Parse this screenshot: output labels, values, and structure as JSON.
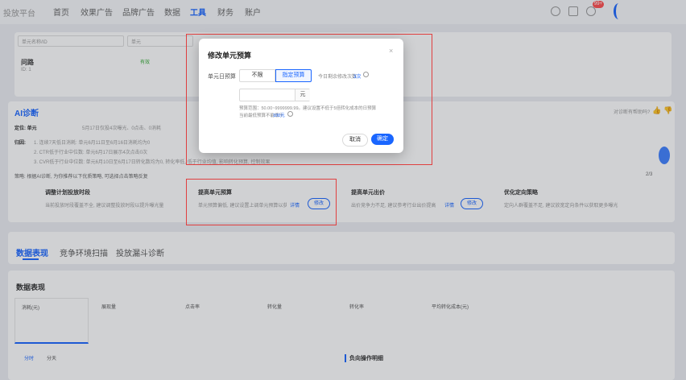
{
  "nav": {
    "brand": "投放平台",
    "items": [
      "首页",
      "效果广告",
      "品牌广告",
      "数据",
      "工具",
      "财务",
      "账户"
    ],
    "active_index": 4,
    "badge": "99+"
  },
  "filter": {
    "unit_id_label": "单元名称/ID",
    "status_label": "单元"
  },
  "unit": {
    "name": "问路",
    "id": "ID: 1",
    "status": "有效"
  },
  "ai": {
    "title": "AI诊断",
    "question": "对诊断有帮助吗?",
    "summary_label": "定位: 单元",
    "summary": "5月17日仅投4次曝光、0点击、0消耗",
    "reason_label": "归因:",
    "reasons": [
      "1. 连续7天低日消耗: 单元6月11日至6月16日消耗均为0",
      "2. CTR低于行业中位数: 单元6月17日展示4次点击0次",
      "3. CVR低于行业中位数: 单元6月10日至6月17日转化数均为0, 转化率低, 低于行业均值, 影响转化预算, 控制效果"
    ],
    "strategy_line": "策略: 根据AI诊断, 为你推荐以下优质策略, 可选择点击策略反复",
    "pager": "2/3"
  },
  "strategies": [
    {
      "title": "调整计划投放时段",
      "desc": "当前投放时段覆盖不全, 建议调整投放时段以提升曝光量",
      "action": ""
    },
    {
      "title": "提高单元预算",
      "desc": "单元预算偏低, 建议设置上调单元预算以获",
      "detail": "详情",
      "action": "修改"
    },
    {
      "title": "提高单元出价",
      "desc": "出价竞争力不足, 建议参考行业出价提高",
      "detail": "详情",
      "action": "修改"
    },
    {
      "title": "优化定向策略",
      "desc": "定向人群覆盖不足, 建议放宽定向条件以获取更多曝光",
      "action": ""
    }
  ],
  "tabs": [
    "数据表现",
    "竞争环境扫描",
    "投放漏斗诊断"
  ],
  "data_section": {
    "title": "数据表现",
    "metrics": [
      "消耗(元)",
      "展现量",
      "点击率",
      "转化量",
      "转化率",
      "平均转化成本(元)"
    ],
    "granularity": [
      "分时",
      "分天"
    ],
    "negative_op_label": "负向操作明细"
  },
  "modal": {
    "title": "修改单元预算",
    "close": "×",
    "budget_label": "单元日预算",
    "options": [
      "不限",
      "指定预算"
    ],
    "selected_option": "指定预算",
    "remaining_prefix": "今日剩余修改次数",
    "remaining_count": "3次",
    "input_value": "",
    "unit": "元",
    "hint_line1": "预算范围：50.00~9999999.99。建议设置不低于5倍转化成本的日预算",
    "hint_line2_prefix": "当前最低预算不能低于",
    "hint_min": "100元",
    "cancel": "取消",
    "confirm": "确定"
  },
  "colors": {
    "accent": "#1a66ff",
    "highlight": "#e04040"
  }
}
